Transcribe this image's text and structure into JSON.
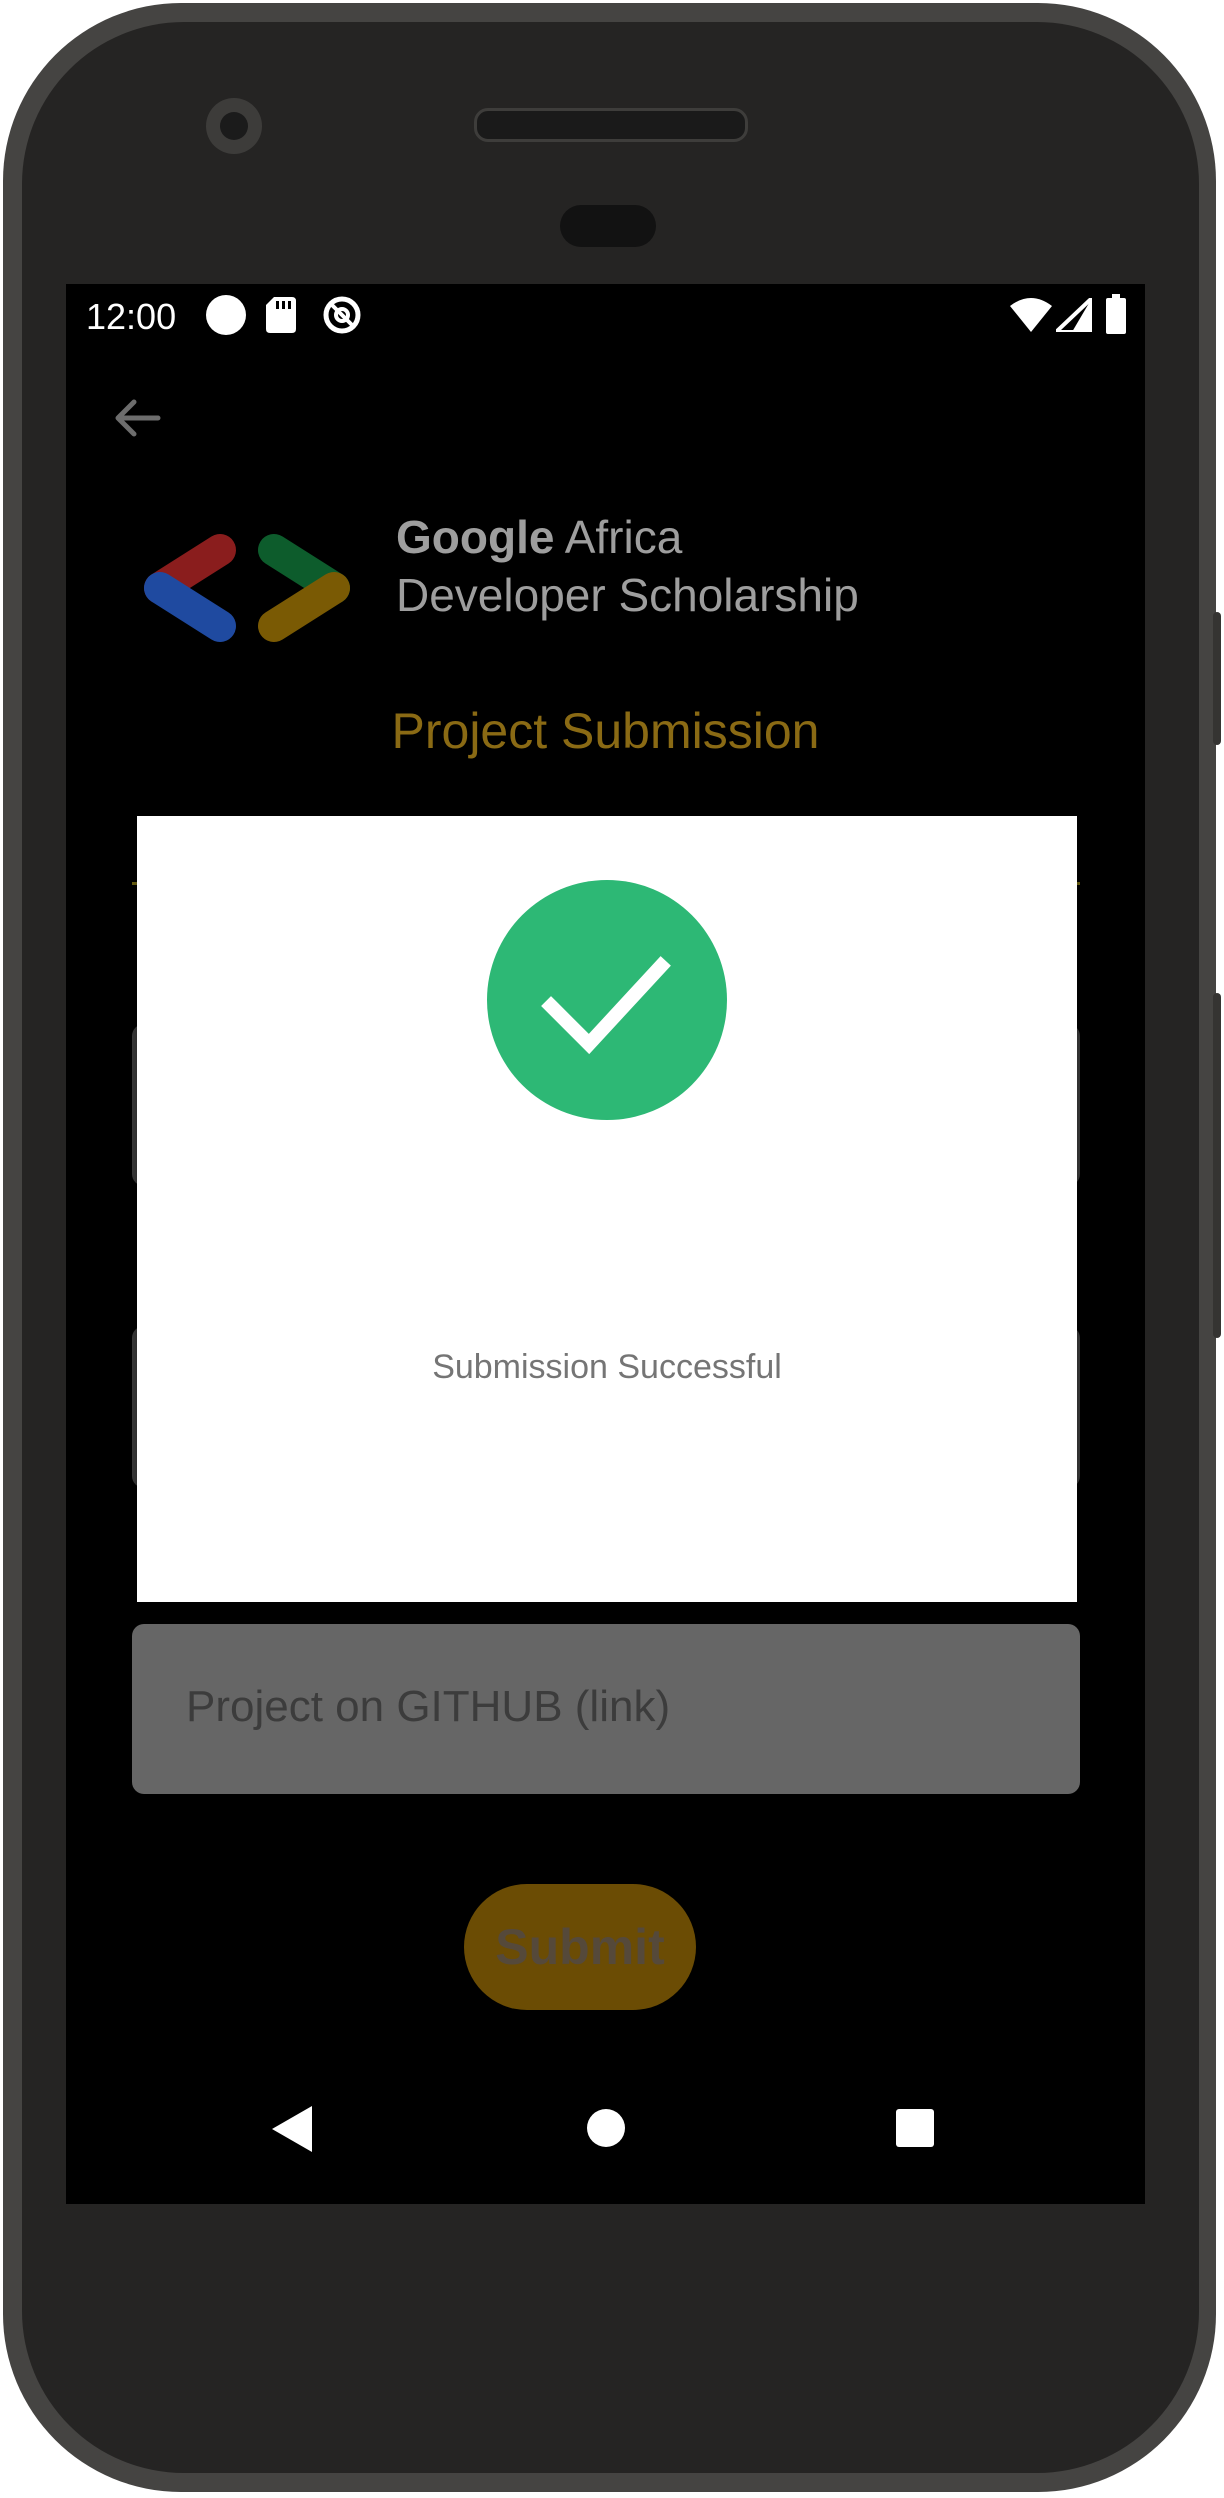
{
  "status_bar": {
    "time": "12:00"
  },
  "header": {
    "brand_line1_bold": "Google",
    "brand_line1_rest": " Africa",
    "brand_line2": "Developer Scholarship",
    "title": "Project Submission"
  },
  "form": {
    "github_placeholder": "Project on GITHUB (link)",
    "submit_label": "Submit"
  },
  "dialog": {
    "message": "Submission Successful"
  },
  "colors": {
    "accent": "#8a6a14",
    "success": "#2db875",
    "logo_red": "#8a1d1d",
    "logo_blue": "#1f4aa0",
    "logo_green": "#0d5c2c",
    "logo_yellow": "#7a5a04"
  }
}
